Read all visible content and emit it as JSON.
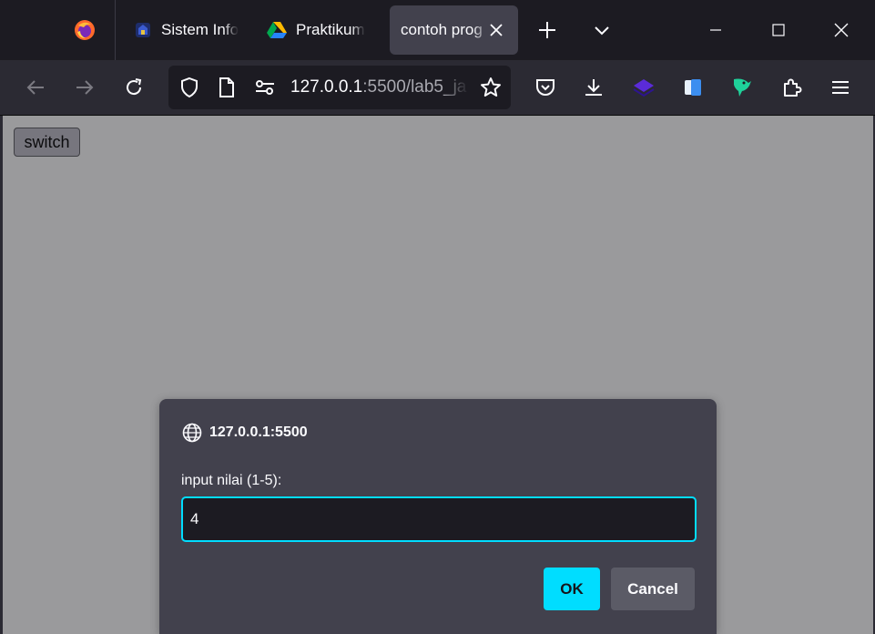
{
  "browser": {
    "tabs": [
      {
        "label": "Sistem Info",
        "icon": "university-logo-icon"
      },
      {
        "label": "Praktikum",
        "icon": "google-drive-icon"
      },
      {
        "label": "contoh prog",
        "active": true
      }
    ],
    "url": {
      "host": "127.0.0.1",
      "rest": ":5500/lab5_ja"
    }
  },
  "page": {
    "switch_label": "switch"
  },
  "dialog": {
    "origin": "127.0.0.1:5500",
    "message": "input nilai (1-5):",
    "input_value": "4",
    "ok_label": "OK",
    "cancel_label": "Cancel"
  },
  "colors": {
    "accent": "#00ddff",
    "dialog_bg": "#42414d",
    "toolbar_bg": "#2b2a33",
    "tabstrip_bg": "#1c1b22"
  }
}
